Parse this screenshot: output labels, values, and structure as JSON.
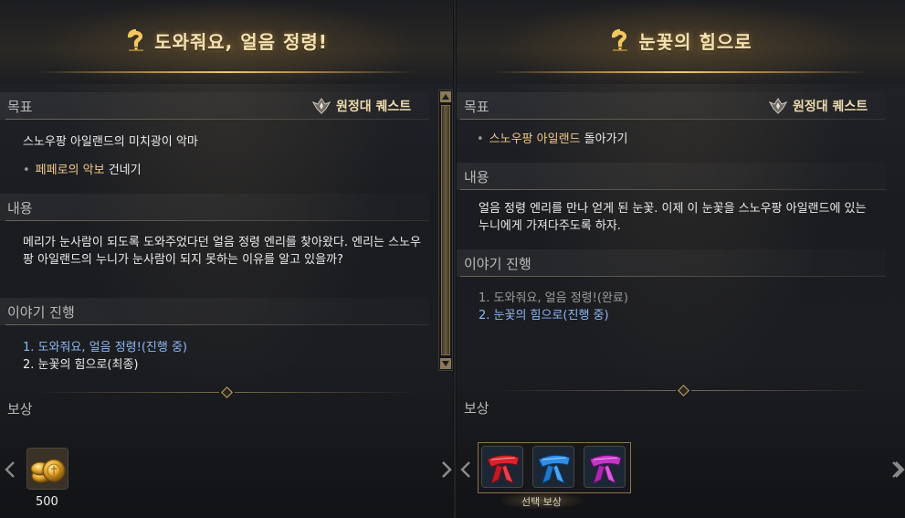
{
  "left": {
    "title": "도와줘요, 얼음 정령!",
    "goal_label": "목표",
    "quest_type": "원정대 퀘스트",
    "goal_line1": "스노우팡 아일랜드의 미치광이 악마",
    "goal_bullet_hl": "페페로의 악보",
    "goal_bullet_rest": " 건네기",
    "content_label": "내용",
    "content_text": "메리가 눈사람이 되도록 도와주었다던 얼음 정령 엔리를 찾아왔다. 엔리는 스노우팡 아일랜드의 누니가 눈사람이 되지 못하는 이유를 알고 있을까?",
    "story_label": "이야기 진행",
    "story": [
      "1. 도와줘요, 얼음 정령!(진행 중)",
      "2. 눈꽃의 힘으로(최종)"
    ],
    "reward_label": "보상",
    "reward_qty": "500"
  },
  "right": {
    "title": "눈꽃의 힘으로",
    "goal_label": "목표",
    "quest_type": "원정대 퀘스트",
    "goal_bullet_hl": "스노우팡 아일랜드",
    "goal_bullet_rest": " 돌아가기",
    "content_label": "내용",
    "content_text": "얼음 정령 엔리를 만나 얻게 된 눈꽃. 이제 이 눈꽃을 스노우팡 아일랜드에 있는 누니에게 가져다주도록 하자.",
    "story_label": "이야기 진행",
    "story": [
      "1. 도와줘요, 얼음 정령!(완료)",
      "2. 눈꽃의 힘으로(진행 중)"
    ],
    "reward_label": "보상",
    "choice_label": "선택 보상"
  },
  "colors": {
    "title": "#f4e2b4",
    "highlight": "#f1c98a",
    "active_story": "#8fb8f2",
    "done_story": "#9c9c9c",
    "scarf_red": "#d8232e",
    "scarf_blue": "#2f8fe8",
    "scarf_magenta": "#c436c8"
  },
  "icons": {
    "title": "quest-exclamation-icon",
    "quest_type": "expedition-emblem-icon",
    "reward_left": "gold-coins-icon",
    "reward_right": [
      "red-scarf-icon",
      "blue-scarf-icon",
      "magenta-scarf-icon"
    ]
  }
}
